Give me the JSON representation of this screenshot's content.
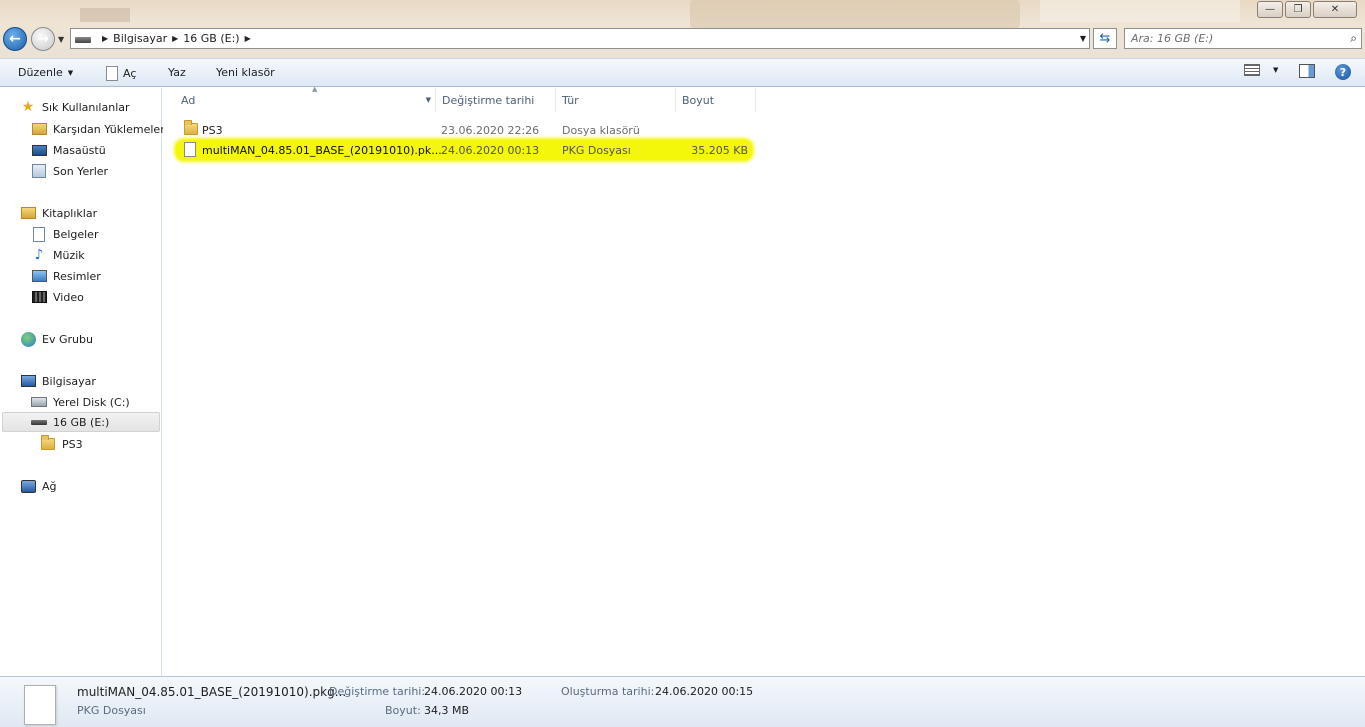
{
  "window": {
    "minimize": "—",
    "maximize": "❐",
    "close": "✕"
  },
  "nav": {
    "back_glyph": "←",
    "forward_glyph": "→",
    "refresh_glyph": "⇆"
  },
  "address": {
    "crumbs": [
      "Bilgisayar",
      "16 GB (E:)"
    ]
  },
  "search": {
    "placeholder": "Ara: 16 GB (E:)"
  },
  "toolbar": {
    "organize": "Düzenle",
    "open": "Aç",
    "print": "Yaz",
    "new_folder": "Yeni klasör"
  },
  "sidebar": {
    "favorites": {
      "label": "Sık Kullanılanlar",
      "items": [
        "Karşıdan Yüklemeler",
        "Masaüstü",
        "Son Yerler"
      ]
    },
    "libraries": {
      "label": "Kitaplıklar",
      "items": [
        "Belgeler",
        "Müzik",
        "Resimler",
        "Video"
      ]
    },
    "homegroup": "Ev Grubu",
    "computer": {
      "label": "Bilgisayar",
      "local_disk": "Yerel Disk (C:)",
      "usb_drive": "16 GB (E:)",
      "ps3_folder": "PS3"
    },
    "network": "Ağ"
  },
  "columns": {
    "name": "Ad",
    "date": "Değiştirme tarihi",
    "type": "Tür",
    "size": "Boyut"
  },
  "files": [
    {
      "name": "PS3",
      "date": "23.06.2020 22:26",
      "type": "Dosya klasörü",
      "size": ""
    },
    {
      "name": "multiMAN_04.85.01_BASE_(20191010).pk...",
      "date": "24.06.2020 00:13",
      "type": "PKG Dosyası",
      "size": "35.205 KB"
    }
  ],
  "details": {
    "filename": "multiMAN_04.85.01_BASE_(20191010).pkg...",
    "filetype": "PKG Dosyası",
    "modified_label": "Değiştirme tarihi:",
    "modified_value": "24.06.2020 00:13",
    "size_label": "Boyut:",
    "size_value": "34,3 MB",
    "created_label": "Oluşturma tarihi:",
    "created_value": "24.06.2020 00:15"
  },
  "colors": {
    "highlight": "#f4f70a",
    "toolbar_top": "#f5f9fd",
    "toolbar_bottom": "#dde8f4"
  }
}
